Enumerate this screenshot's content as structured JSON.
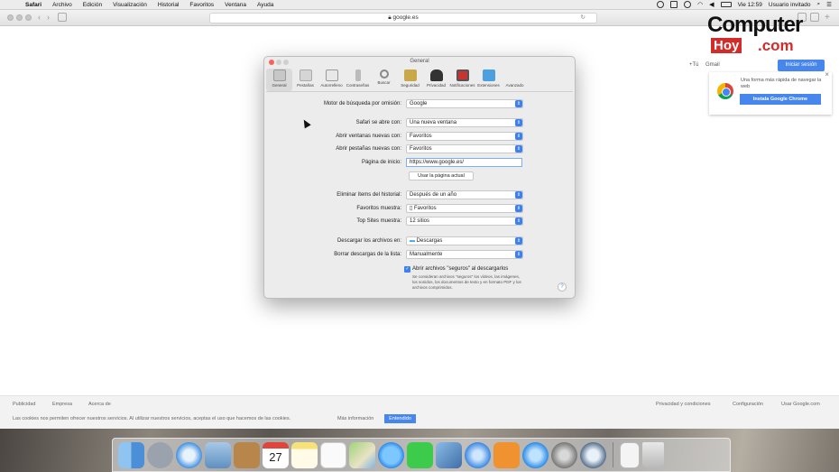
{
  "menubar": {
    "items": [
      "Safari",
      "Archivo",
      "Edición",
      "Visualización",
      "Historial",
      "Favoritos",
      "Ventana",
      "Ayuda"
    ],
    "clock": "Vie 12:59",
    "user": "Usuario invitado"
  },
  "browser": {
    "url": "google.es"
  },
  "google": {
    "top_links": [
      "+Tú",
      "Gmail"
    ],
    "signin": "Iniciar sesión",
    "chrome_promo": {
      "text": "Una forma más rápida de navegar la web",
      "button": "Instala Google Chrome"
    },
    "footer_left": [
      "Publicidad",
      "Empresa",
      "Acerca de"
    ],
    "footer_right": [
      "Privacidad y condiciones",
      "Configuración",
      "Usar Google.com"
    ],
    "cookie_text": "Las cookies nos permiten ofrecer nuestros servicios. Al utilizar nuestros servicios, aceptas el uso que hacemos de las cookies.",
    "cookie_more": "Más información",
    "cookie_button": "Entendido"
  },
  "watermark": {
    "computer": "Computer",
    "hoy": "Hoy",
    "com": ".com"
  },
  "prefs": {
    "title": "General",
    "tabs": [
      {
        "label": "General",
        "icon": "switch-icon"
      },
      {
        "label": "Pestañas",
        "icon": "tabs-icon"
      },
      {
        "label": "Autorrelleno",
        "icon": "pencil-icon"
      },
      {
        "label": "Contraseñas",
        "icon": "key-icon"
      },
      {
        "label": "Buscar",
        "icon": "search-icon"
      },
      {
        "label": "Seguridad",
        "icon": "lock-icon"
      },
      {
        "label": "Privacidad",
        "icon": "person-icon"
      },
      {
        "label": "Notificaciones",
        "icon": "bell-icon"
      },
      {
        "label": "Extensiones",
        "icon": "puzzle-icon"
      },
      {
        "label": "Avanzado",
        "icon": "gear-icon"
      }
    ],
    "search_engine_label": "Motor de búsqueda por omisión:",
    "search_engine": "Google",
    "opens_with_label": "Safari se abre con:",
    "opens_with": "Una nueva ventana",
    "new_windows_label": "Abrir ventanas nuevas con:",
    "new_windows": "Favoritos",
    "new_tabs_label": "Abrir pestañas nuevas con:",
    "new_tabs": "Favoritos",
    "homepage_label": "Página de inicio:",
    "homepage": "https://www.google.es/",
    "use_current_button": "Usar la página actual",
    "remove_history_label": "Eliminar ítems del historial:",
    "remove_history": "Después de un año",
    "favorites_shows_label": "Favoritos muestra:",
    "favorites_shows": "Favoritos",
    "top_sites_label": "Top Sites muestra:",
    "top_sites": "12 sitios",
    "download_to_label": "Descargar los archivos en:",
    "download_to": "Descargas",
    "clear_downloads_label": "Borrar descargas de la lista:",
    "clear_downloads": "Manualmente",
    "safe_files_label": "Abrir archivos \"seguros\" al descargarlos",
    "safe_files_checked": true,
    "safe_files_note": "Se consideran archivos \"seguros\" los vídeos, las imágenes, los sonidos, los documentos de texto y en formato PDF y los archivos comprimidos.",
    "help": "?"
  },
  "dock": {
    "apps": [
      "finder-icon",
      "launchpad-icon",
      "safari-icon",
      "mail-icon",
      "contacts-icon",
      "calendar-icon",
      "notes-icon",
      "reminders-icon",
      "maps-icon",
      "messages-icon",
      "facetime-icon",
      "photos-icon",
      "itunes-icon",
      "ibooks-icon",
      "appstore-icon",
      "system-preferences-icon",
      "quicktime-icon",
      "document-icon",
      "trash-icon"
    ],
    "calendar_day": "27"
  }
}
